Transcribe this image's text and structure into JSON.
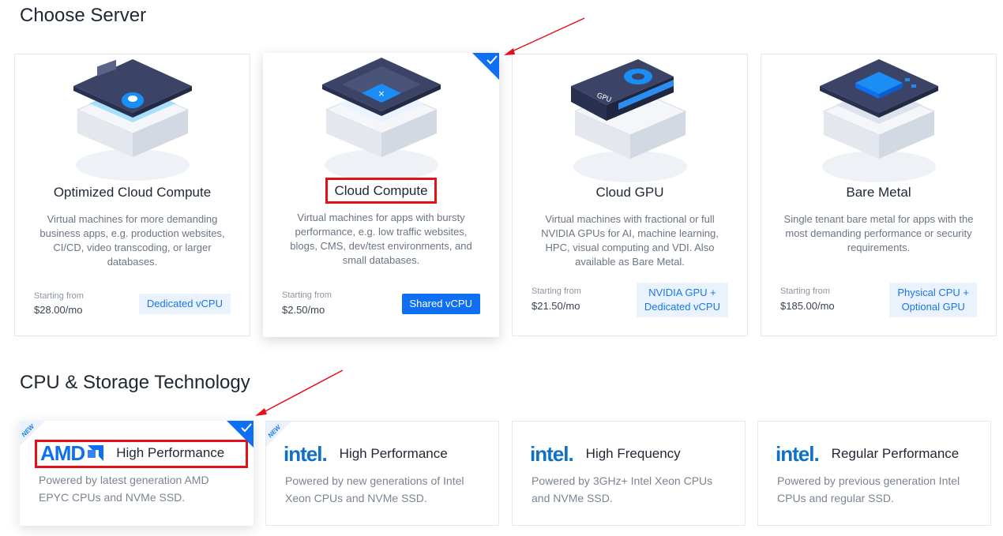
{
  "sections": {
    "server_title": "Choose Server",
    "tech_title": "CPU & Storage Technology"
  },
  "servers": [
    {
      "name": "Optimized Cloud Compute",
      "desc": "Virtual machines for more demanding business apps, e.g. production websites, CI/CD, video transcoding, or larger databases.",
      "start_label": "Starting from",
      "price": "$28.00/mo",
      "tag": "Dedicated vCPU",
      "icon": "optimized-server-icon"
    },
    {
      "name": "Cloud Compute",
      "desc": "Virtual machines for apps with bursty performance, e.g. low traffic websites, blogs, CMS, dev/test environments, and small databases.",
      "start_label": "Starting from",
      "price": "$2.50/mo",
      "tag": "Shared vCPU",
      "icon": "cloud-compute-icon",
      "selected": true
    },
    {
      "name": "Cloud GPU",
      "desc": "Virtual machines with fractional or full NVIDIA GPUs for AI, machine learning, HPC, visual computing and VDI. Also available as Bare Metal.",
      "start_label": "Starting from",
      "price": "$21.50/mo",
      "tag_line1": "NVIDIA GPU +",
      "tag_line2": "Dedicated vCPU",
      "icon": "gpu-icon",
      "gpu_label": "GPU"
    },
    {
      "name": "Bare Metal",
      "desc": "Single tenant bare metal for apps with the most demanding performance or security requirements.",
      "start_label": "Starting from",
      "price": "$185.00/mo",
      "tag_line1": "Physical CPU +",
      "tag_line2": "Optional GPU",
      "icon": "bare-metal-icon"
    }
  ],
  "tech": [
    {
      "brand": "AMD",
      "title": "High Performance",
      "desc": "Powered by latest generation AMD EPYC CPUs and NVMe SSD.",
      "badge": "NEW",
      "selected": true
    },
    {
      "brand": "intel.",
      "title": "High Performance",
      "desc": "Powered by new generations of Intel Xeon CPUs and NVMe SSD.",
      "badge": "NEW"
    },
    {
      "brand": "intel.",
      "title": "High Frequency",
      "desc": "Powered by 3GHz+ Intel Xeon CPUs and NVMe SSD."
    },
    {
      "brand": "intel.",
      "title": "Regular Performance",
      "desc": "Powered by previous generation Intel CPUs and regular SSD."
    }
  ],
  "colors": {
    "accent": "#0f6ff2",
    "highlight": "#e3101a",
    "tag_bg": "#e9f2fd"
  }
}
